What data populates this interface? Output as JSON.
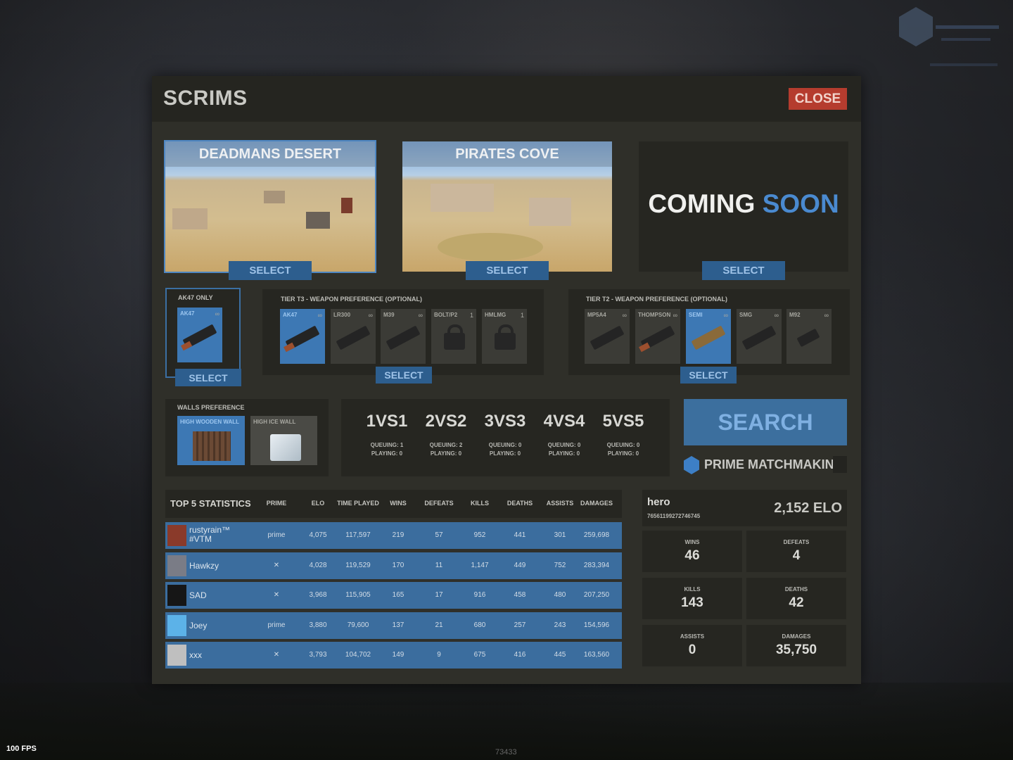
{
  "hud": {
    "fps": "100 FPS",
    "build": "73433"
  },
  "panel": {
    "title": "SCRIMS",
    "close_label": "CLOSE"
  },
  "maps": [
    {
      "name": "DEADMANS DESERT",
      "select": "SELECT",
      "selected": true
    },
    {
      "name": "PIRATES COVE",
      "select": "SELECT",
      "selected": false
    },
    {
      "name_part1": "COMING ",
      "name_part2": "SOON",
      "select": "SELECT"
    }
  ],
  "ak_only": {
    "label": "AK47 ONLY",
    "slot": {
      "name": "AK47",
      "count": "∞",
      "icon": "ak47-icon"
    },
    "select": "SELECT"
  },
  "tier3": {
    "label": "TIER T3 - WEAPON PREFERENCE (OPTIONAL)",
    "slots": [
      {
        "name": "AK47",
        "count": "∞",
        "active": true,
        "locked": false
      },
      {
        "name": "LR300",
        "count": "∞",
        "active": false,
        "locked": false
      },
      {
        "name": "M39",
        "count": "∞",
        "active": false,
        "locked": false
      },
      {
        "name": "BOLT/P2",
        "count": "1",
        "active": false,
        "locked": true
      },
      {
        "name": "HMLMG",
        "count": "1",
        "active": false,
        "locked": true
      }
    ],
    "select": "SELECT"
  },
  "tier2": {
    "label": "TIER T2 - WEAPON PREFERENCE (OPTIONAL)",
    "slots": [
      {
        "name": "MP5A4",
        "count": "∞",
        "active": false
      },
      {
        "name": "THOMPSON",
        "count": "∞",
        "active": false
      },
      {
        "name": "SEMI",
        "count": "∞",
        "active": true
      },
      {
        "name": "SMG",
        "count": "∞",
        "active": false
      },
      {
        "name": "M92",
        "count": "∞",
        "active": false
      }
    ],
    "select": "SELECT"
  },
  "walls": {
    "label": "WALLS PREFERENCE",
    "options": [
      {
        "name": "HIGH WOODEN WALL",
        "active": true
      },
      {
        "name": "HIGH ICE WALL",
        "active": false
      }
    ]
  },
  "modes": [
    {
      "name": "1VS1",
      "queuing": "QUEUING: 1",
      "playing": "PLAYING: 0"
    },
    {
      "name": "2VS2",
      "queuing": "QUEUING: 2",
      "playing": "PLAYING: 0"
    },
    {
      "name": "3VS3",
      "queuing": "QUEUING: 0",
      "playing": "PLAYING: 0"
    },
    {
      "name": "4VS4",
      "queuing": "QUEUING: 0",
      "playing": "PLAYING: 0"
    },
    {
      "name": "5VS5",
      "queuing": "QUEUING: 0",
      "playing": "PLAYING: 0"
    }
  ],
  "search": {
    "label": "SEARCH",
    "prime_label": "PRIME MATCHMAKING"
  },
  "stats": {
    "title": "TOP 5 STATISTICS",
    "headers": [
      "PRIME",
      "ELO",
      "TIME PLAYED",
      "WINS",
      "DEFEATS",
      "KILLS",
      "DEATHS",
      "ASSISTS",
      "DAMAGES"
    ],
    "rows": [
      {
        "name": "rustyrain™ #VTM",
        "prime": "prime",
        "elo": "4,075",
        "time": "117,597",
        "wins": "219",
        "defeats": "57",
        "kills": "952",
        "deaths": "441",
        "assists": "301",
        "damages": "259,698"
      },
      {
        "name": "Hawkzy",
        "prime": "✕",
        "elo": "4,028",
        "time": "119,529",
        "wins": "170",
        "defeats": "11",
        "kills": "1,147",
        "deaths": "449",
        "assists": "752",
        "damages": "283,394"
      },
      {
        "name": "SAD",
        "prime": "✕",
        "elo": "3,968",
        "time": "115,905",
        "wins": "165",
        "defeats": "17",
        "kills": "916",
        "deaths": "458",
        "assists": "480",
        "damages": "207,250"
      },
      {
        "name": "Joey",
        "prime": "prime",
        "elo": "3,880",
        "time": "79,600",
        "wins": "137",
        "defeats": "21",
        "kills": "680",
        "deaths": "257",
        "assists": "243",
        "damages": "154,596"
      },
      {
        "name": "xxx",
        "prime": "✕",
        "elo": "3,793",
        "time": "104,702",
        "wins": "149",
        "defeats": "9",
        "kills": "675",
        "deaths": "416",
        "assists": "445",
        "damages": "163,560"
      }
    ]
  },
  "profile": {
    "name": "hero",
    "steam_id": "76561199272746745",
    "elo": "2,152 ELO",
    "stats": [
      {
        "label": "WINS",
        "value": "46"
      },
      {
        "label": "DEFEATS",
        "value": "4"
      },
      {
        "label": "KILLS",
        "value": "143"
      },
      {
        "label": "DEATHS",
        "value": "42"
      },
      {
        "label": "ASSISTS",
        "value": "0"
      },
      {
        "label": "DAMAGES",
        "value": "35,750"
      }
    ]
  },
  "colors": {
    "accent": "#3d78b4",
    "close": "#b53c2e",
    "panel": "#2f2f29",
    "dark": "#262621"
  }
}
